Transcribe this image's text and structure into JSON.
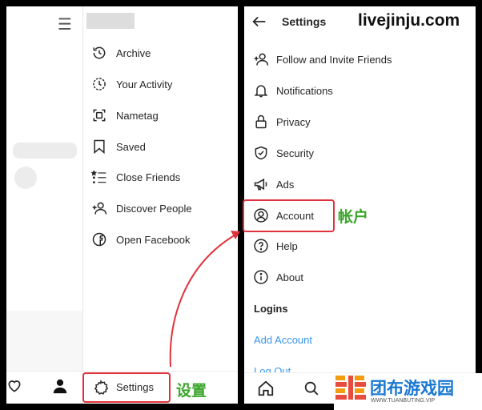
{
  "left_menu": {
    "items": [
      {
        "label": "Archive",
        "icon": "archive-icon"
      },
      {
        "label": "Your Activity",
        "icon": "activity-icon"
      },
      {
        "label": "Nametag",
        "icon": "nametag-icon"
      },
      {
        "label": "Saved",
        "icon": "saved-icon"
      },
      {
        "label": "Close Friends",
        "icon": "close-friends-icon"
      },
      {
        "label": "Discover People",
        "icon": "discover-people-icon"
      },
      {
        "label": "Open Facebook",
        "icon": "facebook-icon"
      }
    ],
    "settings_label": "Settings"
  },
  "right_menu": {
    "title": "Settings",
    "items": [
      {
        "label": "Follow and Invite Friends",
        "icon": "add-person-icon"
      },
      {
        "label": "Notifications",
        "icon": "bell-icon"
      },
      {
        "label": "Privacy",
        "icon": "lock-icon"
      },
      {
        "label": "Security",
        "icon": "shield-icon"
      },
      {
        "label": "Ads",
        "icon": "megaphone-icon"
      },
      {
        "label": "Account",
        "icon": "account-icon"
      },
      {
        "label": "Help",
        "icon": "help-icon"
      },
      {
        "label": "About",
        "icon": "info-icon"
      }
    ],
    "logins_header": "Logins",
    "add_account": "Add Account",
    "log_out": "Log Out"
  },
  "annotations": {
    "account_cn": "帐户",
    "settings_cn": "设置",
    "accent_color": "#e0323c",
    "annotation_color": "#3aa52a"
  },
  "watermarks": {
    "top": "livejinju.com",
    "logo_text": "团布游戏园",
    "logo_sub": "WWW.TUANBUTING.VIP"
  }
}
